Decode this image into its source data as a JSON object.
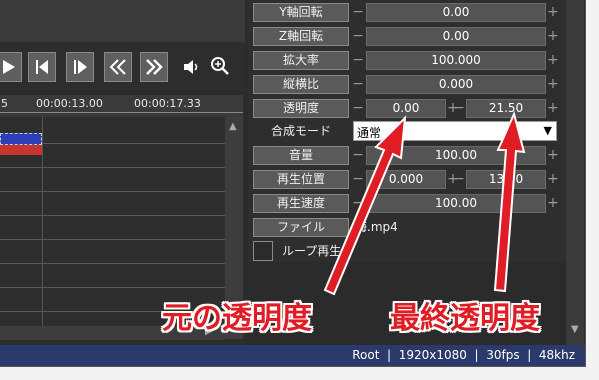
{
  "timeline": {
    "ruler": {
      "t1": "5",
      "t2": "00:00:13.00",
      "t3": "00:00:17.33"
    }
  },
  "properties": {
    "rows": [
      {
        "label": "Y軸回転",
        "value": "0.00"
      },
      {
        "label": "Z軸回転",
        "value": "0.00"
      },
      {
        "label": "拡大率",
        "value": "100.000"
      },
      {
        "label": "縦横比",
        "value": "0.000"
      }
    ],
    "opacity": {
      "label": "透明度",
      "start": "0.00",
      "end": "21.50"
    },
    "blend": {
      "label": "合成モード",
      "value": "通常"
    },
    "volume": {
      "label": "音量",
      "value": "100.00"
    },
    "playpos": {
      "label": "再生位置",
      "start": "0.000",
      "end": "13.50"
    },
    "speed": {
      "label": "再生速度",
      "value": "100.00"
    },
    "file": {
      "label": "ファイル",
      "value": "海.mp4"
    },
    "loop": {
      "label": "ループ再生"
    }
  },
  "status": {
    "text": "Root  |  1920x1080  |  30fps  |  48khz"
  },
  "annotations": {
    "left": "元の透明度",
    "right": "最終透明度"
  },
  "colors": {
    "accent_red": "#e01c25",
    "status_bar": "#2a3a6b"
  }
}
